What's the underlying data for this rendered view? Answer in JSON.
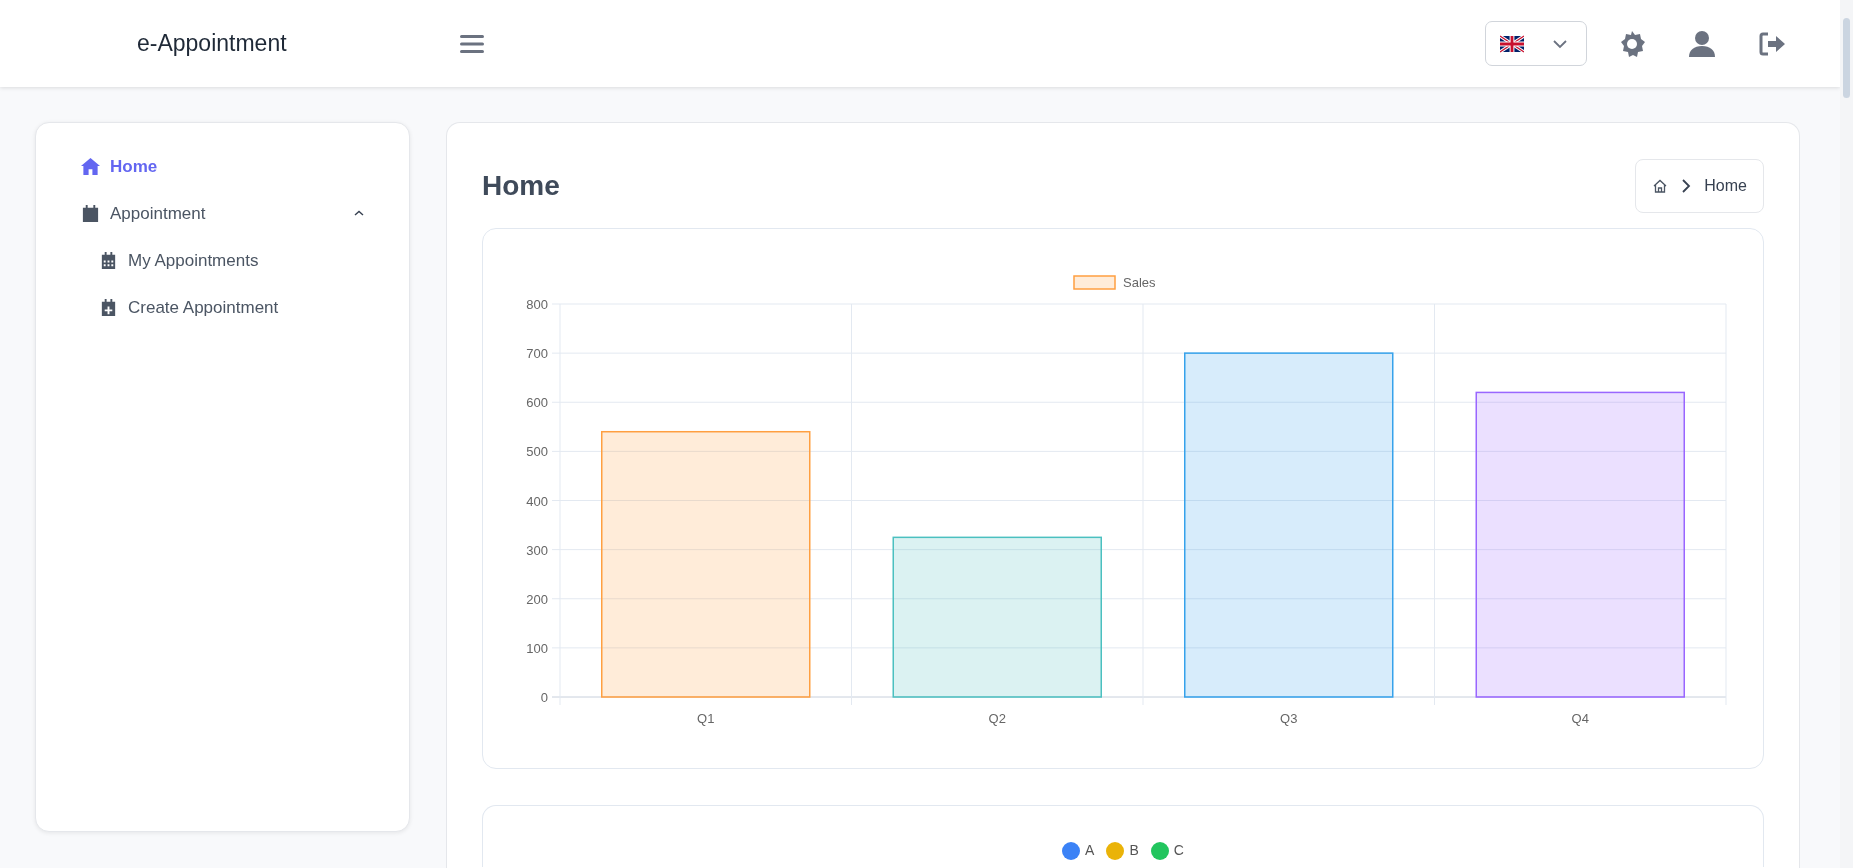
{
  "header": {
    "logo": "e-Appointment"
  },
  "sidebar": {
    "items": [
      {
        "kind": "link",
        "label": "Home",
        "selected": true
      },
      {
        "kind": "group",
        "label": "Appointment",
        "selected": false,
        "expanded": true,
        "children": [
          {
            "kind": "link",
            "label": "My Appointments",
            "selected": false
          },
          {
            "kind": "link",
            "label": "Create Appointment",
            "selected": false
          }
        ]
      }
    ]
  },
  "page": {
    "title": "Home",
    "breadcrumb": [
      "Home"
    ]
  },
  "charts": [
    {
      "chart_data": {
        "type": "bar",
        "categories": [
          "Q1",
          "Q2",
          "Q3",
          "Q4"
        ],
        "series": [
          {
            "name": "Sales",
            "values": [
              540,
              325,
              700,
              620
            ]
          }
        ],
        "ylim": [
          0,
          800
        ],
        "yticks": [
          0,
          100,
          200,
          300,
          400,
          500,
          600,
          700,
          800
        ],
        "grid": true
      },
      "bars": [
        {
          "color": "#ff9f40"
        },
        {
          "color": "#4bc0c0"
        },
        {
          "color": "#36a2eb"
        },
        {
          "color": "#9966ff"
        }
      ]
    },
    {
      "legend": [
        {
          "label": "A",
          "color": "#3b82f6"
        },
        {
          "label": "B",
          "color": "#eab308"
        },
        {
          "label": "C",
          "color": "#22c55e"
        }
      ]
    }
  ]
}
